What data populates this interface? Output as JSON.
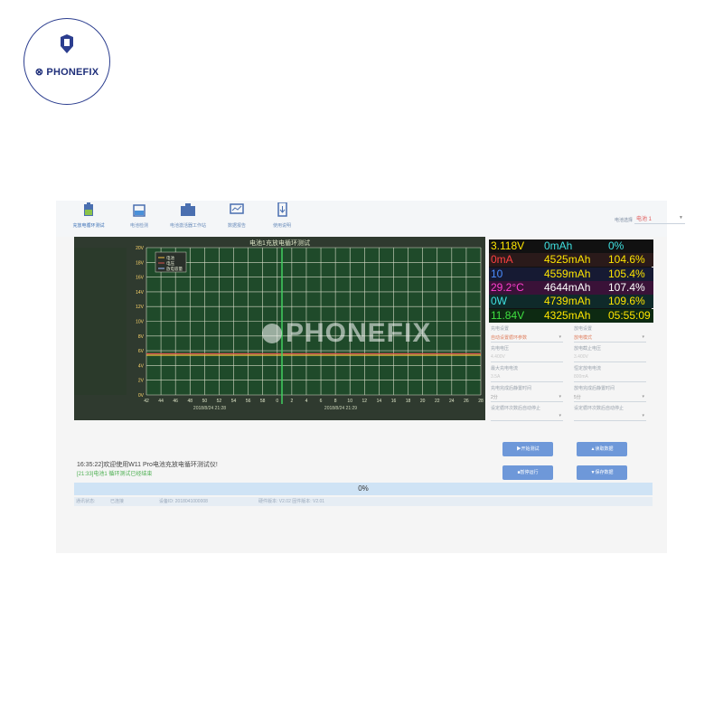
{
  "branding": {
    "logo_text": "PHONEFIX",
    "watermark": "PHONEFIX"
  },
  "toolbar": {
    "buttons": [
      {
        "label": "充放电循环测试",
        "icon": "battery-cycle-icon",
        "active": true
      },
      {
        "label": "电池检测",
        "icon": "battery-icon",
        "active": false
      },
      {
        "label": "电池激活器工作站",
        "icon": "workstation-icon",
        "active": false
      },
      {
        "label": "数据报告",
        "icon": "report-icon",
        "active": false
      },
      {
        "label": "使用说明",
        "icon": "manual-icon",
        "active": false
      }
    ],
    "battery_select_label": "电池选择",
    "battery_select_value": "电池 1"
  },
  "chart": {
    "title": "电池1充放电循环测试",
    "legend": [
      "电池",
      "电压",
      "放电容量"
    ],
    "right_axis_labels": [
      "20V",
      "18V",
      "16V",
      "14V",
      "12V",
      "10V",
      "8V",
      "6V",
      "4V",
      "2V",
      "0V"
    ],
    "x_tick_labels": [
      "42",
      "44",
      "46",
      "48",
      "50",
      "52",
      "54",
      "56",
      "58",
      "0",
      "2",
      "4",
      "6",
      "8",
      "10",
      "12",
      "14",
      "16",
      "18",
      "20",
      "22",
      "24",
      "26",
      "28"
    ],
    "x_date_labels": [
      "2018/8/24 21:28",
      "2018/8/24 21:29"
    ]
  },
  "chart_data": {
    "type": "line",
    "title": "电池1充放电循环测试",
    "legend": [
      "电池",
      "电压",
      "放电容量"
    ],
    "y_right_ticks": [
      20,
      18,
      16,
      14,
      12,
      10,
      8,
      6,
      4,
      2,
      0
    ],
    "ylim": [
      0,
      20
    ],
    "x_ticks": [
      42,
      44,
      46,
      48,
      50,
      52,
      54,
      56,
      58,
      0,
      2,
      4,
      6,
      8,
      10,
      12,
      14,
      16,
      18,
      20,
      22,
      24,
      26,
      28
    ],
    "series": [
      {
        "name": "电池",
        "color": "#f5c242",
        "level": 5.4
      },
      {
        "name": "电压",
        "color": "#d9534f",
        "level": 5.6
      }
    ],
    "grid": true,
    "legend_position": "top-left"
  },
  "readout": {
    "rows": [
      [
        {
          "text": "3.118V",
          "color": "#ffe600"
        },
        {
          "text": "0mAh",
          "color": "#3fe0e0"
        },
        {
          "text": "0%",
          "color": "#3fe0e0"
        }
      ],
      [
        {
          "text": "0mA",
          "color": "#ff4040"
        },
        {
          "text": "4525mAh",
          "color": "#ffe600"
        },
        {
          "text": "104.6%",
          "color": "#ffe600"
        }
      ],
      [
        {
          "text": "10",
          "color": "#4a8cff"
        },
        {
          "text": "4559mAh",
          "color": "#ffe600"
        },
        {
          "text": "105.4%",
          "color": "#ffe600"
        }
      ],
      [
        {
          "text": "29.2°C",
          "color": "#ff3fd0"
        },
        {
          "text": "4644mAh",
          "color": "#ffffff"
        },
        {
          "text": "107.4%",
          "color": "#ffffff"
        }
      ],
      [
        {
          "text": "0W",
          "color": "#3fe0e0"
        },
        {
          "text": "4739mAh",
          "color": "#ffe600"
        },
        {
          "text": "109.6%",
          "color": "#ffe600"
        }
      ],
      [
        {
          "text": "11.84V",
          "color": "#3fe040"
        },
        {
          "text": "4325mAh",
          "color": "#ffe600"
        },
        {
          "text": "05:55:09",
          "color": "#ffe600"
        }
      ]
    ],
    "row_backgrounds": [
      "#111111",
      "#2a1a1a",
      "#161a33",
      "#3a1238",
      "#0f2a2a",
      "#0d2a12"
    ],
    "col_backgrounds": [
      "",
      "",
      ""
    ]
  },
  "settings": {
    "charge_settings_label": "充电设置",
    "discharge_settings_label": "放电设置",
    "charge_mode": "自动设置循环参数",
    "discharge_mode": "放电模式",
    "charge_voltage_label": "充电电压",
    "discharge_cutoff_label": "放电截止电压",
    "charge_voltage": "4.400V",
    "discharge_cutoff": "3.400V",
    "max_charge_current_label": "最大充电电流",
    "discharge_current_label": "恒定放电电流",
    "max_charge_current": "3.5A",
    "discharge_current": "800mA",
    "charge_rest_label": "充电完成后静置时间",
    "discharge_rest_label": "放电完成后静置时间",
    "charge_rest": "2分",
    "discharge_rest": "5分",
    "cycle_auto_stop_label": "设定循环次数后自动停止",
    "cycle_auto_stop2_label": "设定循环次数后自动停止"
  },
  "actions": {
    "start_test": "▶开始测试",
    "export": "▲读取数据",
    "stop": "■暂停运行",
    "save": "▼保存数据"
  },
  "log": {
    "line1": "16:35:22]欢迎使用W11 Pro电池充放电循环测试仪!",
    "line2": "[21:33]电池1 循环测试已经结束"
  },
  "progress": {
    "percent": 0,
    "label": "0%"
  },
  "statusbar": {
    "items": [
      "通讯状态:",
      "已连接",
      "设备ID: 2018041000008",
      "硬件版本: V2.02 固件版本: V2.01"
    ]
  }
}
